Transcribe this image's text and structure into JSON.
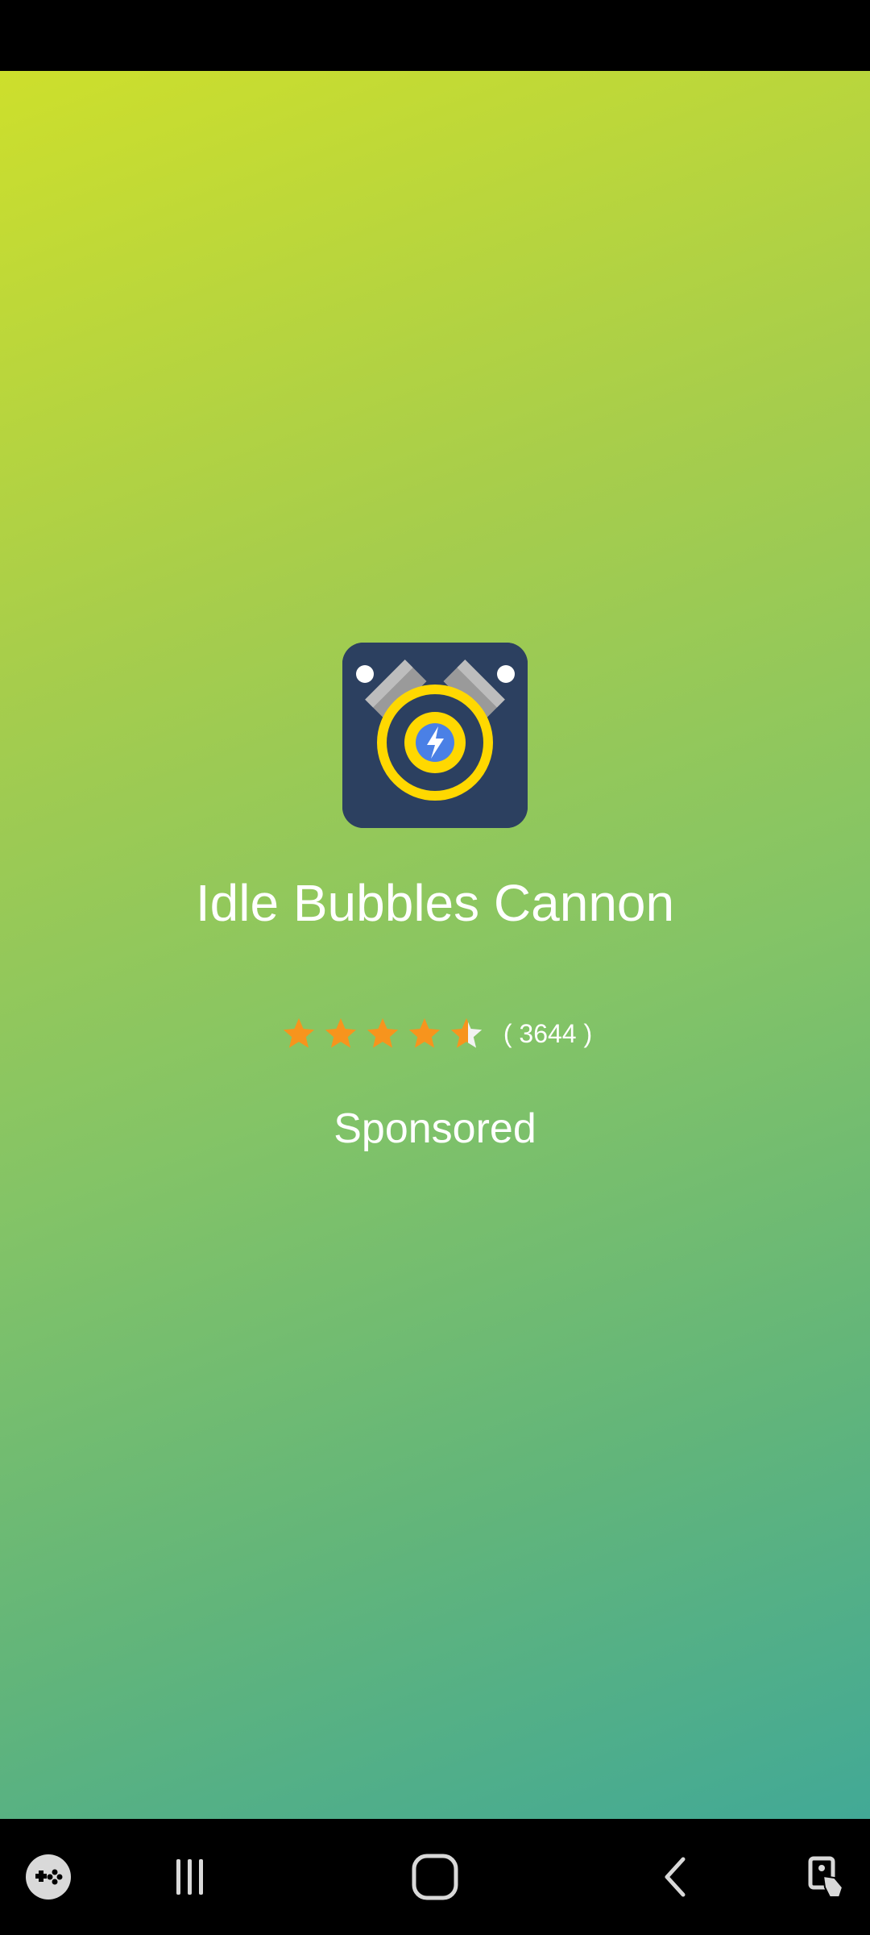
{
  "app": {
    "name": "Idle Bubbles Cannon",
    "rating": 4.5,
    "rating_max": 5,
    "rating_count_text": "( 3644 )",
    "icon": "bubble-cannon-app-icon"
  },
  "ad": {
    "sponsored_label": "Sponsored"
  },
  "colors": {
    "gradient_top": "#cddf2c",
    "gradient_bottom": "#42a996",
    "icon_background": "#2c4060",
    "star_color": "#f7941d",
    "text_color": "#ffffff"
  },
  "nav_bar": {
    "items": [
      {
        "name": "game-launcher-icon"
      },
      {
        "name": "recent-apps-icon"
      },
      {
        "name": "home-icon"
      },
      {
        "name": "back-icon"
      },
      {
        "name": "accessibility-icon"
      }
    ]
  }
}
